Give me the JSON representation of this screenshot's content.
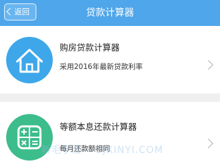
{
  "navbar": {
    "back_label": "返回",
    "title": "贷款计算器",
    "background_color": "#4fa6ea"
  },
  "calculators": [
    {
      "title": "购房贷款计算器",
      "subtitle": "采用2016年最新贷款利率",
      "icon": "house-icon",
      "icon_color": "#3ea7ea"
    },
    {
      "title": "等额本息还款计算器",
      "subtitle": "每月还款额相同",
      "icon": "calculator-icon",
      "icon_color": "#3dbc8c"
    }
  ],
  "watermark": "新毛学游 • SJXINYI.COM"
}
